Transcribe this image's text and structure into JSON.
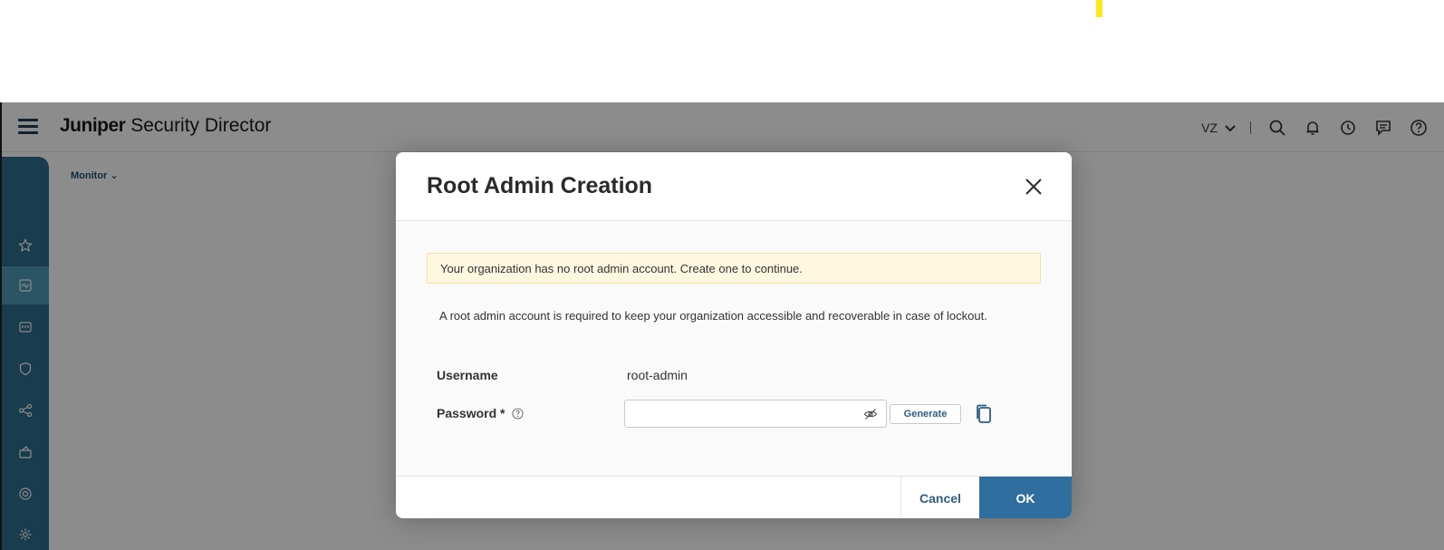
{
  "app": {
    "brand_bold": "Juniper",
    "brand_rest": "Security Director",
    "org_code": "VZ",
    "breadcrumb": "Monitor",
    "header_icons": [
      "search-icon",
      "bell-icon",
      "clock-icon",
      "chat-icon",
      "help-icon"
    ],
    "nav_icons": [
      "star-icon",
      "monitor-icon",
      "devices-icon",
      "shield-icon",
      "share-icon",
      "bag-icon",
      "target-icon",
      "gear-icon"
    ]
  },
  "modal": {
    "title": "Root Admin Creation",
    "alert": "Your organization has no root admin account. Create one to continue.",
    "description": "A root admin account is required to keep your organization accessible and recoverable in case of lockout.",
    "username_label": "Username",
    "username_value": "root-admin",
    "password_label": "Password *",
    "password_value": "",
    "generate_label": "Generate",
    "cancel_label": "Cancel",
    "ok_label": "OK"
  },
  "colors": {
    "nav": "#2f6e8e",
    "primary": "#2f6e9e",
    "alert_bg": "#fff8e1"
  }
}
